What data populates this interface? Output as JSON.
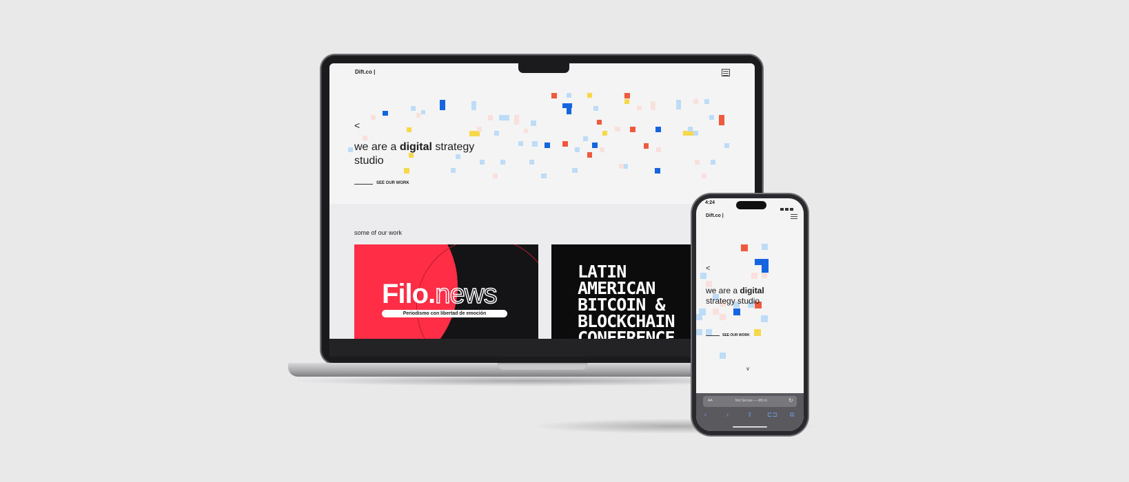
{
  "laptop": {
    "site": {
      "logo": "Dift.co |",
      "back_arrow": "<",
      "headline": {
        "prefix": "we are a ",
        "bold": "digital",
        "suffix": " strategy studio"
      },
      "cta": "SEE OUR WORK",
      "work_title": "some of our work",
      "cards": [
        {
          "logo_main": "Filo.",
          "logo_accent": "news",
          "tagline": "Periodismo con libertad de emoción"
        },
        {
          "text": "LATIN\nAMERICAN\nBITCOIN &\nBLOCKCHAIN\nCONFERENCE"
        }
      ]
    }
  },
  "phone": {
    "status_time": "4:24",
    "site": {
      "logo": "Dift.co |",
      "back_arrow": "<",
      "headline": {
        "prefix": "we are a ",
        "bold": "digital",
        "suffix": " strategy studio"
      },
      "cta": "SEE OUR WORK",
      "down_arrow": "v"
    },
    "browser": {
      "aa": "AA",
      "url": "Not Secure — dift.co",
      "reload": "↻",
      "nav": [
        "‹",
        "›",
        "⇪",
        "⊏⊐",
        "⧉"
      ]
    }
  },
  "colors": {
    "accent_blue": "#1565e0",
    "accent_red": "#ef5a3f",
    "accent_yellow": "#f7d84a",
    "light_blue": "#bcdcf7",
    "pale_pink": "#f9e0dc",
    "filo_red": "#ff2d46"
  }
}
